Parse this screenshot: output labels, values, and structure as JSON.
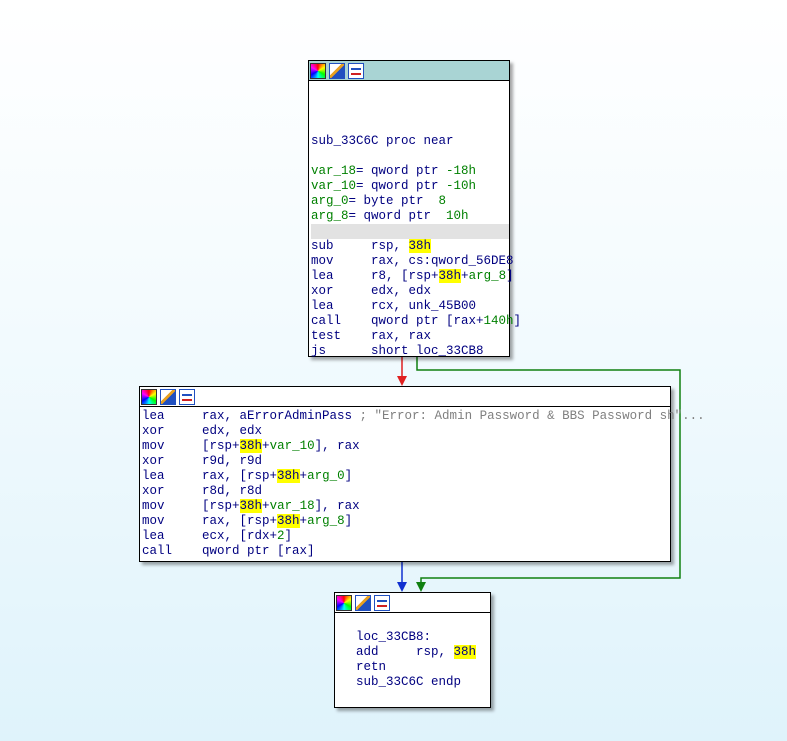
{
  "colors": {
    "edge_false": "#e02020",
    "edge_true": "#108010",
    "edge_flow": "#1030d0",
    "header_selected": "#a9d4d4"
  },
  "header_icons": [
    "color-palette-icon",
    "edit-pencil-icon",
    "graph-overview-icon"
  ],
  "blocks": [
    {
      "name": "block-sub-33c6c",
      "selected_line": 9,
      "lines": [
        [],
        [],
        [],
        [
          {
            "t": "sub_33C6C proc near",
            "s": "n"
          }
        ],
        [],
        [
          {
            "t": "var_18",
            "s": "g"
          },
          {
            "t": "= qword ptr ",
            "s": "n"
          },
          {
            "t": "-18h",
            "s": "g"
          }
        ],
        [
          {
            "t": "var_10",
            "s": "g"
          },
          {
            "t": "= qword ptr ",
            "s": "n"
          },
          {
            "t": "-10h",
            "s": "g"
          }
        ],
        [
          {
            "t": "arg_0",
            "s": "g"
          },
          {
            "t": "= byte ptr  ",
            "s": "n"
          },
          {
            "t": "8",
            "s": "g"
          }
        ],
        [
          {
            "t": "arg_8",
            "s": "g"
          },
          {
            "t": "= qword ptr  ",
            "s": "n"
          },
          {
            "t": "10h",
            "s": "g"
          }
        ],
        [],
        [
          {
            "t": "sub     rsp, ",
            "s": "n"
          },
          {
            "t": "38h",
            "s": "hl"
          }
        ],
        [
          {
            "t": "mov     rax, cs:qword_56DE8",
            "s": "n"
          }
        ],
        [
          {
            "t": "lea     r8, [rsp+",
            "s": "n"
          },
          {
            "t": "38h",
            "s": "hl"
          },
          {
            "t": "+",
            "s": "n"
          },
          {
            "t": "arg_8",
            "s": "g"
          },
          {
            "t": "]",
            "s": "n"
          }
        ],
        [
          {
            "t": "xor     edx, edx",
            "s": "n"
          }
        ],
        [
          {
            "t": "lea     rcx, unk_45B00",
            "s": "n"
          }
        ],
        [
          {
            "t": "call    qword ptr [rax+",
            "s": "n"
          },
          {
            "t": "140h",
            "s": "g"
          },
          {
            "t": "]",
            "s": "n"
          }
        ],
        [
          {
            "t": "test    rax, rax",
            "s": "n"
          }
        ],
        [
          {
            "t": "js      short loc_33CB8",
            "s": "n"
          }
        ]
      ]
    },
    {
      "name": "block-error-call",
      "lines": [
        [
          {
            "t": "lea     rax, aErrorAdminPass ",
            "s": "n"
          },
          {
            "t": "; \"Error: Admin Password & BBS Password sh\"...",
            "s": "c"
          }
        ],
        [
          {
            "t": "xor     edx, edx",
            "s": "n"
          }
        ],
        [
          {
            "t": "mov     [rsp+",
            "s": "n"
          },
          {
            "t": "38h",
            "s": "hl"
          },
          {
            "t": "+",
            "s": "n"
          },
          {
            "t": "var_10",
            "s": "g"
          },
          {
            "t": "], rax",
            "s": "n"
          }
        ],
        [
          {
            "t": "xor     r9d, r9d",
            "s": "n"
          }
        ],
        [
          {
            "t": "lea     rax, [rsp+",
            "s": "n"
          },
          {
            "t": "38h",
            "s": "hl"
          },
          {
            "t": "+",
            "s": "n"
          },
          {
            "t": "arg_0",
            "s": "g"
          },
          {
            "t": "]",
            "s": "n"
          }
        ],
        [
          {
            "t": "xor     r8d, r8d",
            "s": "n"
          }
        ],
        [
          {
            "t": "mov     [rsp+",
            "s": "n"
          },
          {
            "t": "38h",
            "s": "hl"
          },
          {
            "t": "+",
            "s": "n"
          },
          {
            "t": "var_18",
            "s": "g"
          },
          {
            "t": "], rax",
            "s": "n"
          }
        ],
        [
          {
            "t": "mov     rax, [rsp+",
            "s": "n"
          },
          {
            "t": "38h",
            "s": "hl"
          },
          {
            "t": "+",
            "s": "n"
          },
          {
            "t": "arg_8",
            "s": "g"
          },
          {
            "t": "]",
            "s": "n"
          }
        ],
        [
          {
            "t": "lea     ecx, [rdx+",
            "s": "n"
          },
          {
            "t": "2",
            "s": "g"
          },
          {
            "t": "]",
            "s": "n"
          }
        ],
        [
          {
            "t": "call    qword ptr [rax]",
            "s": "n"
          }
        ]
      ]
    },
    {
      "name": "block-loc-33cb8",
      "lines": [
        [],
        [
          {
            "t": "loc_33CB8:",
            "s": "n"
          }
        ],
        [
          {
            "t": "add     rsp, ",
            "s": "n"
          },
          {
            "t": "38h",
            "s": "hl"
          }
        ],
        [
          {
            "t": "retn",
            "s": "n"
          }
        ],
        [
          {
            "t": "sub_33C6C endp",
            "s": "n"
          }
        ]
      ]
    }
  ]
}
